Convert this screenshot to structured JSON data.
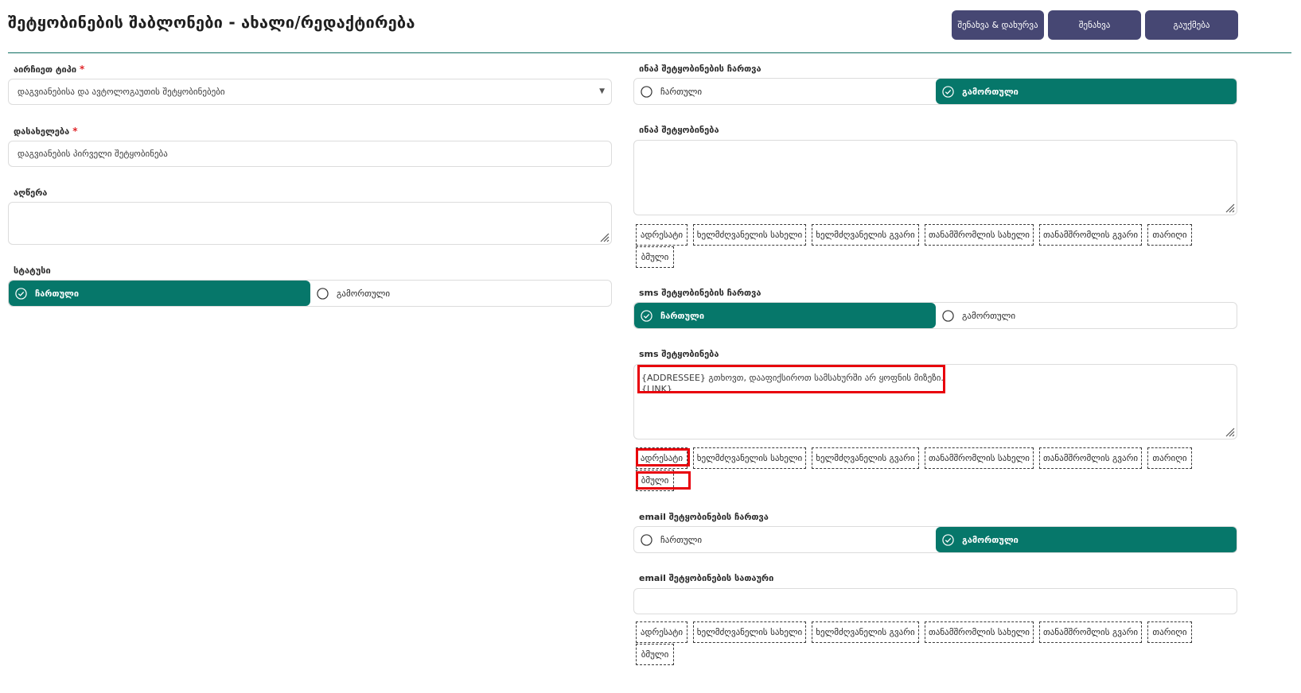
{
  "header": {
    "title": "შეტყობინების შაბლონები - ახალი/რედაქტირება",
    "save_close_label": "შენახვა & დახურვა",
    "save_label": "შენახვა",
    "cancel_label": "გაუქმება"
  },
  "left": {
    "choose_type": {
      "label": "აირჩიეთ ტიპი",
      "value": "დაგვიანებისა და ავტოლოგაუთის შეტყობინებები"
    },
    "name": {
      "label": "დასახელება",
      "value": "დაგვიანების პირველი შეტყობინება"
    },
    "description": {
      "label": "აღწერა",
      "value": ""
    },
    "status": {
      "label": "სტატუსი",
      "on": "ჩართული",
      "off": "გამორთული"
    }
  },
  "right": {
    "inapp_toggle": {
      "label": "ინაპ შეტყობინების ჩართვა",
      "on": "ჩართული",
      "off": "გამორთული"
    },
    "inapp_message": {
      "label": "ინაპ შეტყობინება",
      "value": ""
    },
    "sms_toggle": {
      "label": "sms შეტყობინების ჩართვა",
      "on": "ჩართული",
      "off": "გამორთული"
    },
    "sms_message": {
      "label": "sms შეტყობინება",
      "line1": "{ADDRESSEE} გთხოვთ, დააფიქსიროთ სამსახურში არ ყოფნის მიზეზი.",
      "line2": "{LINK}"
    },
    "email_toggle": {
      "label": "email შეტყობინების ჩართვა",
      "on": "ჩართული",
      "off": "გამორთული"
    },
    "email_subject": {
      "label": "email შეტყობინების სათაური",
      "value": ""
    }
  },
  "placeholders": [
    "ადრესატი",
    "ხელმძღვანელის სახელი",
    "ხელმძღვანელის გვარი",
    "თანამშრომლის სახელი",
    "თანამშრომლის გვარი",
    "თარიღი",
    "ბმული"
  ],
  "colors": {
    "accent": "#06776a",
    "header_button": "#464773",
    "required": "#e0262a",
    "highlight": "#e8000b"
  }
}
